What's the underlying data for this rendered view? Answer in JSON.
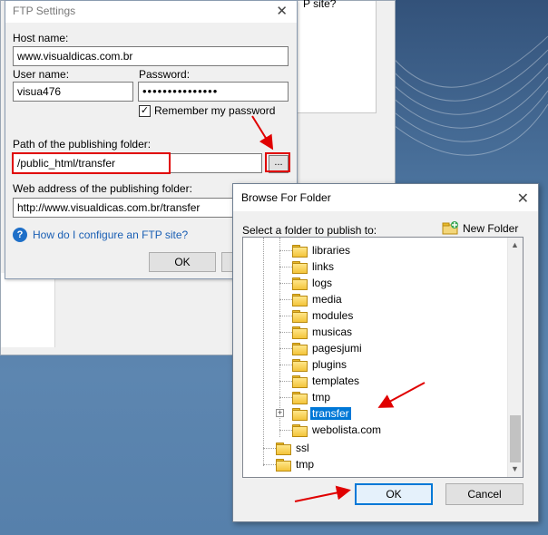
{
  "ftp_settings": {
    "title": "FTP Settings",
    "host_label": "Host name:",
    "host_value": "www.visualdicas.com.br",
    "user_label": "User name:",
    "user_value": "visua476",
    "password_label": "Password:",
    "password_value": "•••••••••••••••",
    "remember_label": "Remember my password",
    "remember_checked": "✓",
    "path_label": "Path of the publishing folder:",
    "path_value": "/public_html/transfer",
    "browse_label": "...",
    "web_label": "Web address of the publishing folder:",
    "web_value": "http://www.visualdicas.com.br/transfer",
    "help_link": "How do I configure an FTP site?",
    "ok_label": "OK"
  },
  "back_window": {
    "partial_text": "P site?"
  },
  "browse_dialog": {
    "title": "Browse For Folder",
    "prompt": "Select a folder to publish to:",
    "new_folder_label": "New Folder",
    "folders": [
      "libraries",
      "links",
      "logs",
      "media",
      "modules",
      "musicas",
      "pagesjumi",
      "plugins",
      "templates",
      "tmp",
      "transfer",
      "webolista.com"
    ],
    "root_folders": [
      "ssl",
      "tmp"
    ],
    "selected_folder": "transfer",
    "ok_label": "OK",
    "cancel_label": "Cancel"
  },
  "colors": {
    "highlight": "#0078d7",
    "annotation_red": "#e00000",
    "folder_yellow": "#f3c43a"
  }
}
